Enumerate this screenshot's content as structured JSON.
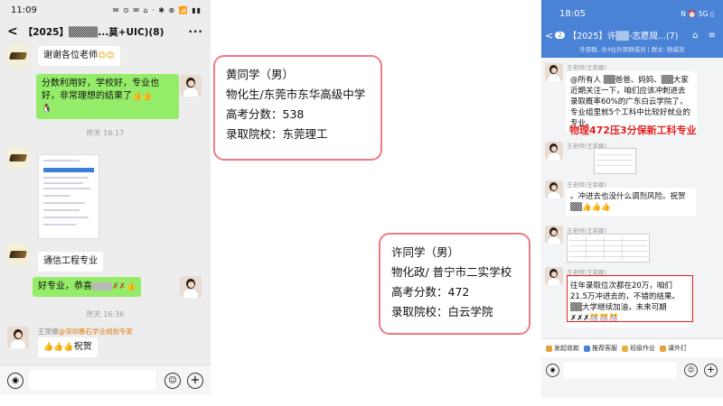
{
  "left_phone": {
    "status": {
      "time": "11:09",
      "icons": "✉ ⊙ ✉ ⌂ · ✱ ⊗ 📶 ▮▮",
      "battery": "▭"
    },
    "header": {
      "back": "<",
      "title": "【2025】▒▒▒▒...莫+UIC)(8)",
      "more": "···"
    },
    "messages": [
      {
        "text": "谢谢各位老师",
        "emoji": "😊😊"
      },
      {
        "text": "分数利用好，学校好，专业也好，非常理想的结果了",
        "emoji": "👍👍"
      },
      {
        "text": "",
        "emoji": "🐧"
      }
    ],
    "time1": "昨天 16:17",
    "msg_major": "通信工程专业",
    "msg_congrats": {
      "text": "好专业，恭喜",
      "marks": "✗✗",
      "emoji": "👍"
    },
    "time2": "昨天 16:36",
    "sender": {
      "name": "王荣娜",
      "org": "@深圳慕石学业规划专家"
    },
    "msg_last": {
      "emoji": "👍👍👍",
      "text": "祝贺"
    }
  },
  "card1": {
    "line1": "黄同学（男）",
    "line2": "物化生/东莞市东华高级中学",
    "line3": "高考分数：538",
    "line4": "录取院校：东莞理工"
  },
  "card2": {
    "line1": "许同学（男）",
    "line2": "物化政/ 普宁市二实学校",
    "line3": "高考分数：472",
    "line4": "录取院校：白云学院"
  },
  "right_phone": {
    "status": {
      "time": "18:05",
      "icons": "N ⏰ 5G ▯"
    },
    "header": {
      "badge": "2",
      "title": "【2025】许▒▒-志愿规...(7)",
      "icons": "⌂ ≡"
    },
    "subheader": "外部群, 含4位外部群成员 | 群主: 欧威良",
    "sender1": "王老师(王荣娜)",
    "msg1": "@所有人 ▒▒爸爸、妈妈、▒▒大家近期关注一下，咱们应该冲刺进去录取概率60%的广东白云学院了，专业组里就5个工科中比较好就业的专业。",
    "highlight": "物理472压3分保新工科专业",
    "sender2": "王老师(王荣娜)",
    "sender3": "王老师(王荣娜)",
    "msg3": "。冲进去也没什么调剂风险。祝贺▒▒👍👍👍",
    "sender4": "王老师(王荣娜)",
    "sender5": "王老师(王荣娜)",
    "msg5": "往年录取位次都在20万，咱们21.5万冲进去的，不错的结果。▒▒大学继续加油，未来可期✗✗✗🎊🎊🎊",
    "tabs": [
      "发起收款",
      "推荐客服",
      "班级作业",
      "课外打"
    ]
  },
  "colors": {
    "wechat_green": "#95ec69",
    "card_border": "#f07a84",
    "wecom_blue": "#4a82d6",
    "highlight_red": "#e52020"
  }
}
